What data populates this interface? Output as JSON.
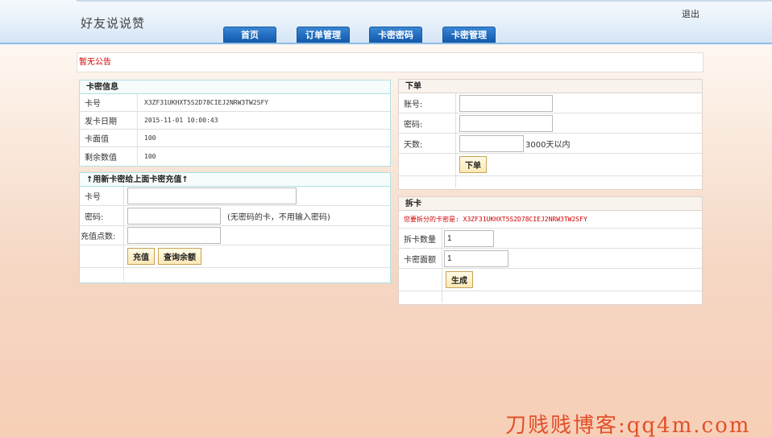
{
  "header": {
    "site_title": "好友说说赞",
    "logout": "退出",
    "tabs": [
      "首页",
      "订单管理",
      "卡密密码",
      "卡密管理"
    ]
  },
  "notice": "暂无公告",
  "card_info": {
    "title": "卡密信息",
    "rows": [
      {
        "label": "卡号",
        "value": "X3ZF31UKHXT5S2D78CIEJ2NRW3TW2SFY"
      },
      {
        "label": "发卡日期",
        "value": "2015-11-01 10:00:43"
      },
      {
        "label": "卡面值",
        "value": "100"
      },
      {
        "label": "剩余数值",
        "value": "100"
      }
    ]
  },
  "recharge": {
    "title": "↑用新卡密给上面卡密充值↑",
    "card_label": "卡号",
    "card_value": "",
    "password_label": "密码:",
    "password_value": "",
    "password_hint": "(无密码的卡，不用输入密码)",
    "points_label": "充值点数:",
    "points_value": "",
    "recharge_button": "充值",
    "query_button": "查询余额"
  },
  "order": {
    "title": "下单",
    "account_label": "账号:",
    "account_value": "",
    "password_label": "密码:",
    "password_value": "",
    "days_label": "天数:",
    "days_value": "",
    "days_hint": "3000天以内",
    "submit_button": "下单"
  },
  "split": {
    "title": "拆卡",
    "message": "您要拆分的卡密是: X3ZF31UKHXT5S2D78CIEJ2NRW3TW2SFY",
    "count_label": "拆卡数量",
    "count_value": "1",
    "face_label": "卡密面额",
    "face_value": "1",
    "generate_button": "生成"
  },
  "watermark": "刀贱贱博客:qq4m.com",
  "colors": {
    "tab_blue": "#1f69bc",
    "notice_red": "#d00000",
    "watermark": "#e2502a"
  }
}
